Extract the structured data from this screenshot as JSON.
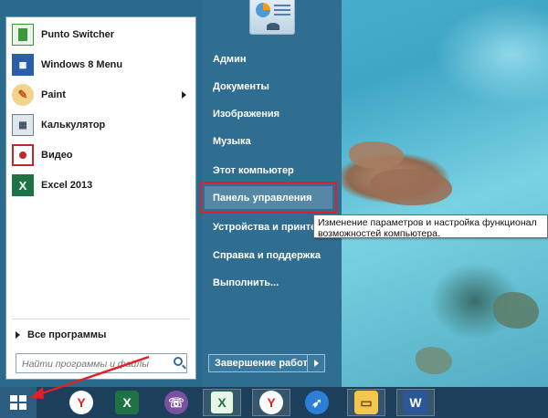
{
  "programs": [
    {
      "label": "Punto Switcher",
      "icon": "punto-switcher-icon",
      "color": "#3a9a3a",
      "has_submenu": false
    },
    {
      "label": "Windows 8 Menu",
      "icon": "windows8-menu-icon",
      "color": "#2a5ea8",
      "has_submenu": false
    },
    {
      "label": "Paint",
      "icon": "paint-icon",
      "color": "#e2a23a",
      "has_submenu": true
    },
    {
      "label": "Калькулятор",
      "icon": "calculator-icon",
      "color": "#6a7f93",
      "has_submenu": false
    },
    {
      "label": "Видео",
      "icon": "video-icon",
      "color": "#c0262d",
      "has_submenu": false
    },
    {
      "label": "Excel 2013",
      "icon": "excel-icon",
      "color": "#1f7244",
      "has_submenu": false
    }
  ],
  "all_programs_label": "Все программы",
  "search": {
    "placeholder": "Найти программы и файлы"
  },
  "right_menu": [
    "Админ",
    "Документы",
    "Изображения",
    "Музыка",
    "Этот компьютер",
    "Панель управления",
    "Устройства и принтер",
    "Справка и поддержка",
    "Выполнить..."
  ],
  "highlighted_item": "Панель управления",
  "shutdown_label": "Завершение работы",
  "tooltip": {
    "line1": "Изменение параметров и настройка функционал",
    "line2": "возможностей компьютера."
  },
  "taskbar": [
    {
      "name": "yandex-browser-icon",
      "glyph": "Y",
      "color": "#e2231a",
      "bg": "#ffffff"
    },
    {
      "name": "excel-taskbar-icon",
      "glyph": "X",
      "color": "#ffffff",
      "bg": "#1f7244"
    },
    {
      "name": "viber-icon",
      "glyph": "☏",
      "color": "#ffffff",
      "bg": "#7b519d"
    },
    {
      "name": "excel-2-taskbar-icon",
      "glyph": "X",
      "color": "#1f7244",
      "bg": "#e9f4ea"
    },
    {
      "name": "yandex-2-taskbar-icon",
      "glyph": "Y",
      "color": "#e2231a",
      "bg": "#ffffff"
    },
    {
      "name": "bird-app-icon",
      "glyph": "➶",
      "color": "#ffffff",
      "bg": "#2b7fd6"
    },
    {
      "name": "file-explorer-icon",
      "glyph": "▭",
      "color": "#6b4a12",
      "bg": "#f3c74c"
    },
    {
      "name": "word-icon",
      "glyph": "W",
      "color": "#ffffff",
      "bg": "#2b579a"
    }
  ],
  "colors": {
    "accent": "#2f6e91",
    "highlight_border": "#e01f26"
  }
}
